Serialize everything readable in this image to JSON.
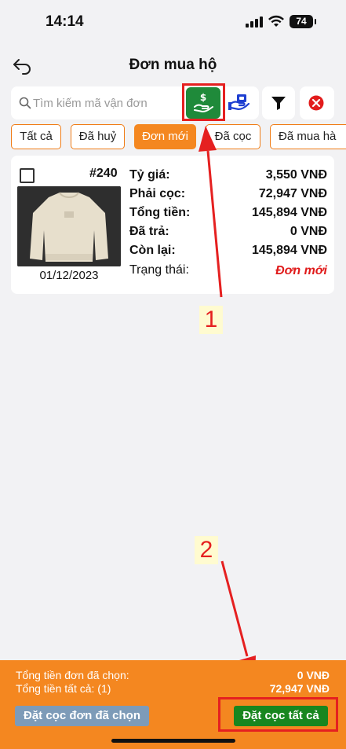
{
  "status_bar": {
    "time": "14:14",
    "battery": "74"
  },
  "header": {
    "title": "Đơn mua hộ"
  },
  "search": {
    "placeholder": "Tìm kiếm mã vận đơn"
  },
  "tabs": [
    {
      "label": "Tất cả",
      "active": false
    },
    {
      "label": "Đã huỷ",
      "active": false
    },
    {
      "label": "Đơn mới",
      "active": true
    },
    {
      "label": "Đã cọc",
      "active": false
    },
    {
      "label": "Đã mua hà",
      "active": false
    }
  ],
  "order": {
    "id": "#240",
    "date": "01/12/2023",
    "rows": [
      {
        "label": "Tỷ giá:",
        "value": "3,550 VNĐ"
      },
      {
        "label": "Phải cọc:",
        "value": "72,947 VNĐ"
      },
      {
        "label": "Tổng tiền:",
        "value": "145,894 VNĐ"
      },
      {
        "label": "Đã trả:",
        "value": "0 VNĐ"
      },
      {
        "label": "Còn lại:",
        "value": "145,894 VNĐ"
      },
      {
        "label": "Trạng thái:",
        "value": "Đơn mới"
      }
    ]
  },
  "annotations": {
    "one": "1",
    "two": "2"
  },
  "footer": {
    "selected_total_label": "Tổng tiền đơn đã chọn:",
    "selected_total_value": "0 VNĐ",
    "all_total_label": "Tổng tiền tất cả: (1)",
    "all_total_value": "72,947 VNĐ",
    "deposit_selected_label": "Đặt cọc đơn đã chọn",
    "deposit_all_label": "Đặt cọc tất cả"
  },
  "colors": {
    "accent": "#f48720",
    "green": "#1f8a3a",
    "status_new": "#e01b1b",
    "annotation": "#e52020"
  }
}
